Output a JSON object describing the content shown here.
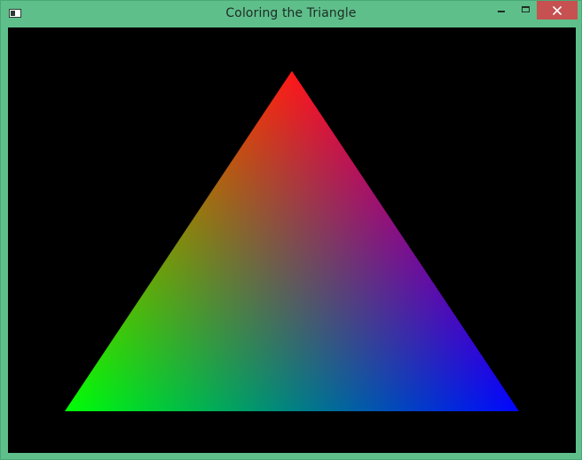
{
  "window": {
    "title": "Coloring the Triangle",
    "frame_color": "#5ebf8b",
    "close_button_color": "#c75050"
  },
  "titlebar": {
    "icons": {
      "app": "window-app-icon",
      "minimize": "minimize-icon",
      "maximize": "maximize-icon",
      "close": "close-icon"
    }
  },
  "canvas": {
    "background": "#000000",
    "triangle": {
      "vertex_colors": {
        "top": "#ff0000",
        "bottom_left": "#00ff00",
        "bottom_right": "#0000ff"
      }
    }
  }
}
